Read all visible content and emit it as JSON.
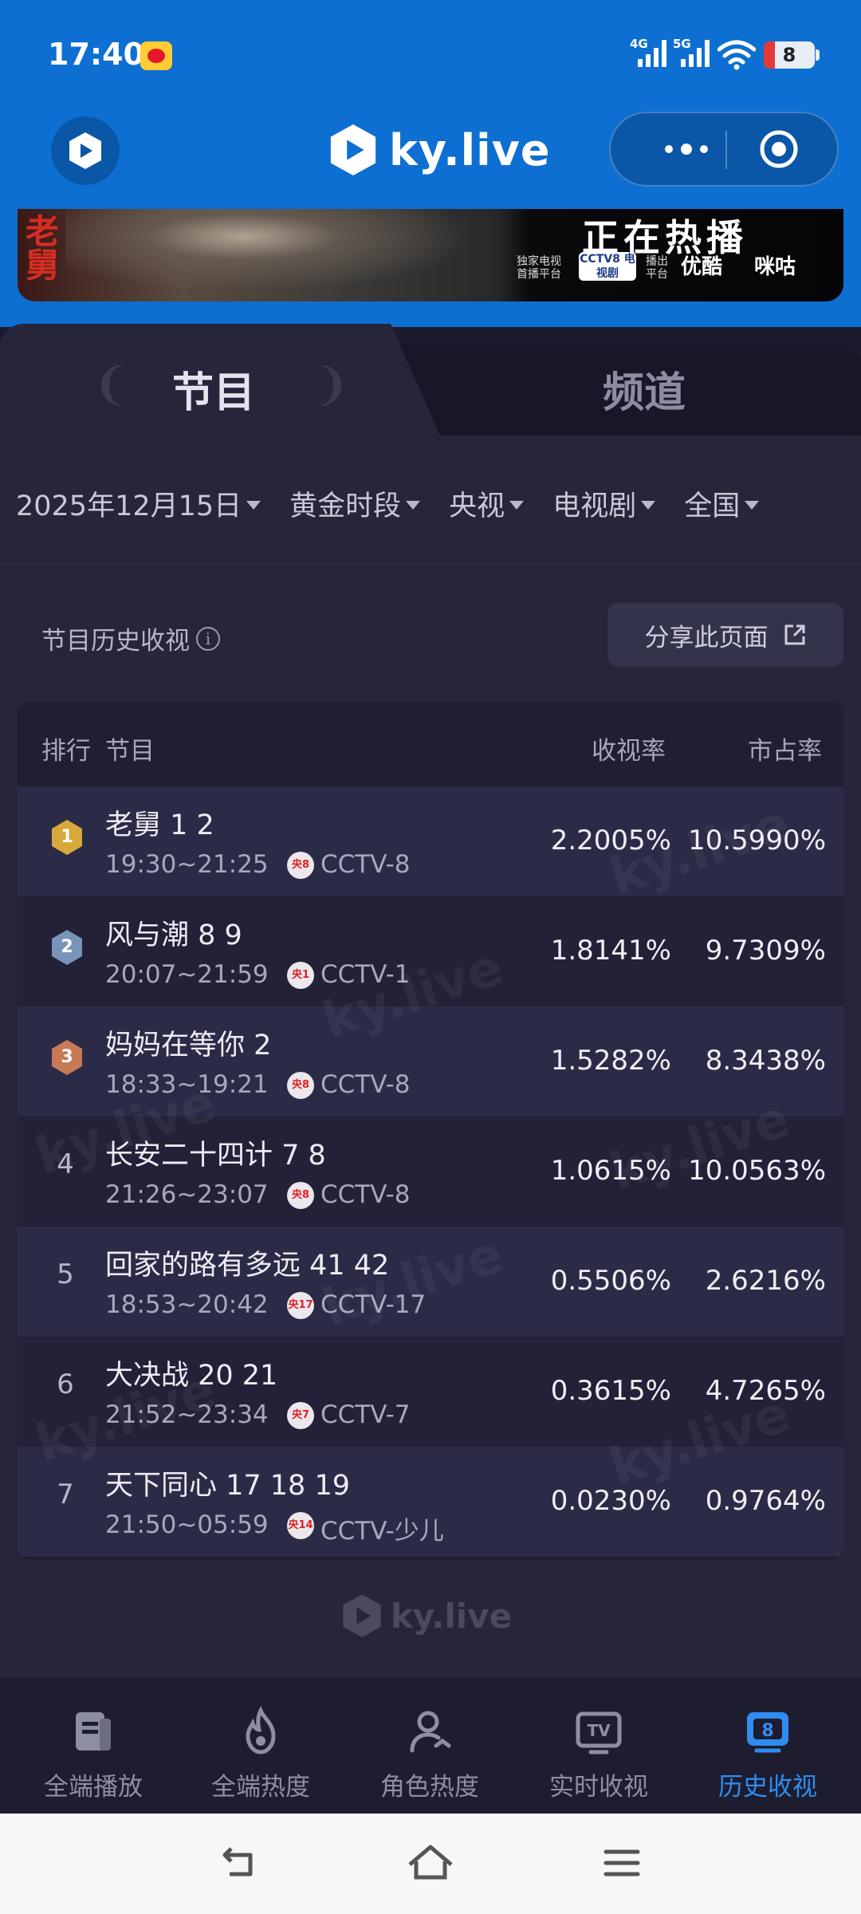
{
  "status_bar": {
    "time": "17:40",
    "signal1": "4G",
    "signal2": "5G",
    "battery": "8"
  },
  "app_header": {
    "brand": "ky.live"
  },
  "banner": {
    "title": "正在热播",
    "left_small": "独家电视 首播平台",
    "cctv_badge": "CCTV8 电视剧",
    "mid_small": "播出 平台",
    "youku": "优酷",
    "migu": "咪咕"
  },
  "tabs": [
    {
      "label": "节目",
      "active": true
    },
    {
      "label": "频道",
      "active": false
    }
  ],
  "filters": [
    {
      "label": "2025年12月15日"
    },
    {
      "label": "黄金时段"
    },
    {
      "label": "央视"
    },
    {
      "label": "电视剧"
    },
    {
      "label": "全国"
    }
  ],
  "section": {
    "title": "节目历史收视",
    "share_button": "分享此页面"
  },
  "table": {
    "headers": {
      "rank": "排行",
      "program": "节目",
      "rating": "收视率",
      "share": "市占率"
    },
    "rows": [
      {
        "rank": "1",
        "title": "老舅 1 2",
        "time": "19:30~21:25",
        "channel_badge": "央8",
        "channel": "CCTV-8",
        "rating": "2.2005%",
        "share": "10.5990%",
        "medal": "gold"
      },
      {
        "rank": "2",
        "title": "风与潮 8 9",
        "time": "20:07~21:59",
        "channel_badge": "央1",
        "channel": "CCTV-1",
        "rating": "1.8141%",
        "share": "9.7309%",
        "medal": "silver"
      },
      {
        "rank": "3",
        "title": "妈妈在等你 2",
        "time": "18:33~19:21",
        "channel_badge": "央8",
        "channel": "CCTV-8",
        "rating": "1.5282%",
        "share": "8.3438%",
        "medal": "bronze"
      },
      {
        "rank": "4",
        "title": "长安二十四计 7 8",
        "time": "21:26~23:07",
        "channel_badge": "央8",
        "channel": "CCTV-8",
        "rating": "1.0615%",
        "share": "10.0563%"
      },
      {
        "rank": "5",
        "title": "回家的路有多远 41 42",
        "time": "18:53~20:42",
        "channel_badge": "央17",
        "channel": "CCTV-17",
        "rating": "0.5506%",
        "share": "2.6216%"
      },
      {
        "rank": "6",
        "title": "大决战 20 21",
        "time": "21:52~23:34",
        "channel_badge": "央7",
        "channel": "CCTV-7",
        "rating": "0.3615%",
        "share": "4.7265%"
      },
      {
        "rank": "7",
        "title": "天下同心 17 18 19",
        "time": "21:50~05:59",
        "channel_badge": "央14",
        "channel": "CCTV-少儿",
        "rating": "0.0230%",
        "share": "0.9764%"
      }
    ]
  },
  "footer": {
    "brand": "ky.live"
  },
  "bottom_nav": [
    {
      "label": "全端播放",
      "icon": "book-icon",
      "active": false
    },
    {
      "label": "全端热度",
      "icon": "flame-icon",
      "active": false
    },
    {
      "label": "角色热度",
      "icon": "user-icon",
      "active": false
    },
    {
      "label": "实时收视",
      "icon": "tv-icon",
      "active": false
    },
    {
      "label": "历史收视",
      "icon": "history-icon",
      "active": true
    }
  ],
  "colors": {
    "header_blue": "#0d6fd1",
    "bg": "#1c1b2e",
    "active_nav": "#2f8cf0",
    "gold": "#d8a93a",
    "silver": "#7a93b8",
    "bronze": "#c77a55"
  }
}
